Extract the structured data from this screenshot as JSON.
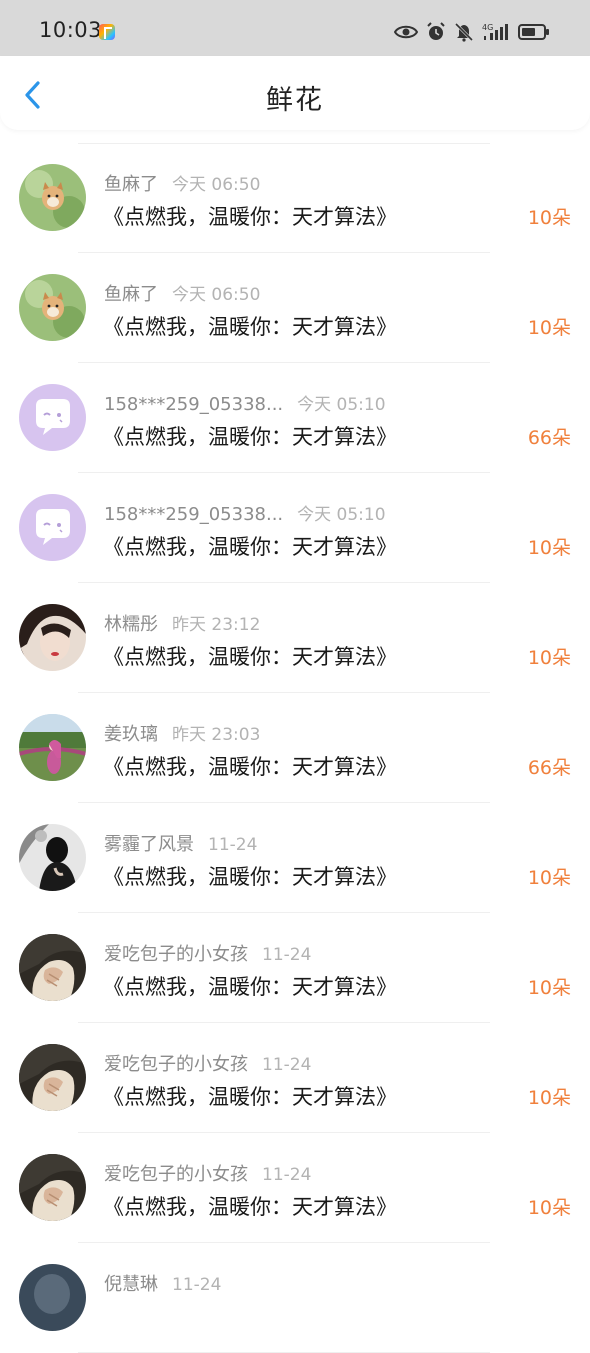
{
  "status_bar": {
    "time": "10:03",
    "network": "4G"
  },
  "header": {
    "title": "鲜花",
    "back_icon": "chevron-left-icon"
  },
  "colors": {
    "accent": "#2b95e9",
    "count": "#f0803c",
    "status_bar_bg": "#d9d9d9"
  },
  "items": [
    {
      "avatar": "shiba-dog-photo",
      "username": "鱼麻了",
      "time": "今天 06:50",
      "title": "《点燃我，温暖你：天才算法》",
      "count": "10朵"
    },
    {
      "avatar": "shiba-dog-photo",
      "username": "鱼麻了",
      "time": "今天 06:50",
      "title": "《点燃我，温暖你：天才算法》",
      "count": "10朵"
    },
    {
      "avatar": "purple-chat-default",
      "username": "158***259_05338...",
      "time": "今天 05:10",
      "title": "《点燃我，温暖你：天才算法》",
      "count": "66朵"
    },
    {
      "avatar": "purple-chat-default",
      "username": "158***259_05338...",
      "time": "今天 05:10",
      "title": "《点燃我，温暖你：天才算法》",
      "count": "10朵"
    },
    {
      "avatar": "woman-portrait",
      "username": "林糯彤",
      "time": "昨天 23:12",
      "title": "《点燃我，温暖你：天才算法》",
      "count": "10朵"
    },
    {
      "avatar": "garden-photo",
      "username": "姜玖璃",
      "time": "昨天 23:03",
      "title": "《点燃我，温暖你：天才算法》",
      "count": "66朵"
    },
    {
      "avatar": "bw-portrait",
      "username": "雾霾了风景",
      "time": "11-24",
      "title": "《点燃我，温暖你：天才算法》",
      "count": "10朵"
    },
    {
      "avatar": "hands-photo",
      "username": "爱吃包子的小女孩",
      "time": "11-24",
      "title": "《点燃我，温暖你：天才算法》",
      "count": "10朵"
    },
    {
      "avatar": "hands-photo",
      "username": "爱吃包子的小女孩",
      "time": "11-24",
      "title": "《点燃我，温暖你：天才算法》",
      "count": "10朵"
    },
    {
      "avatar": "hands-photo",
      "username": "爱吃包子的小女孩",
      "time": "11-24",
      "title": "《点燃我，温暖你：天才算法》",
      "count": "10朵"
    },
    {
      "avatar": "partial-avatar",
      "username": "倪慧琳",
      "time": "11-24",
      "title": "",
      "count": ""
    }
  ]
}
